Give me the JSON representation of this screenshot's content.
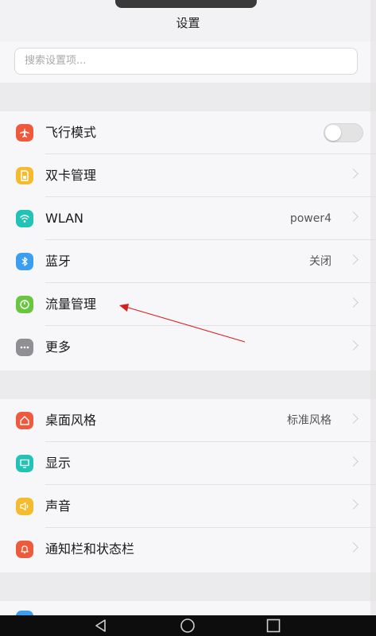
{
  "header": {
    "title": "设置"
  },
  "search": {
    "placeholder": "搜索设置项..."
  },
  "group1": [
    {
      "label": "飞行模式",
      "icon": "airplane-icon",
      "color": "#f05a3c",
      "type": "toggle",
      "toggle_on": false
    },
    {
      "label": "双卡管理",
      "icon": "sim-card-icon",
      "color": "#f4bb2f",
      "type": "chevron"
    },
    {
      "label": "WLAN",
      "icon": "wifi-icon",
      "color": "#20c3b6",
      "value": "power4",
      "type": "chevron"
    },
    {
      "label": "蓝牙",
      "icon": "bluetooth-icon",
      "color": "#3c9ef0",
      "value": "关闭",
      "type": "chevron"
    },
    {
      "label": "流量管理",
      "icon": "data-usage-icon",
      "color": "#6ac640",
      "type": "chevron"
    },
    {
      "label": "更多",
      "icon": "more-icon",
      "color": "#8f8f94",
      "type": "chevron"
    }
  ],
  "group2": [
    {
      "label": "桌面风格",
      "icon": "home-style-icon",
      "color": "#f05a3c",
      "value": "标准风格",
      "type": "chevron"
    },
    {
      "label": "显示",
      "icon": "display-icon",
      "color": "#20c3b6",
      "type": "chevron"
    },
    {
      "label": "声音",
      "icon": "sound-icon",
      "color": "#f4bb2f",
      "type": "chevron"
    },
    {
      "label": "通知栏和状态栏",
      "icon": "notification-icon",
      "color": "#f05a3c",
      "type": "chevron"
    }
  ],
  "navbar": {
    "buttons": [
      "back-icon",
      "home-icon",
      "recents-icon"
    ]
  },
  "annotation": {
    "color": "#d62020"
  }
}
